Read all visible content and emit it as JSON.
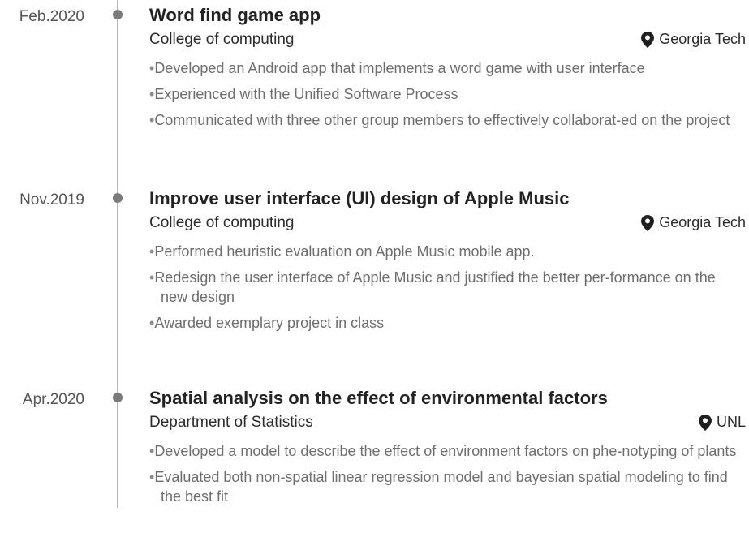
{
  "entries": [
    {
      "date": "Feb.2020",
      "title": "Word find game app",
      "org": "College of computing",
      "location": "Georgia Tech",
      "bullets": [
        "Developed an Android app that implements a word game with user interface",
        "Experienced with the Unified Software Process",
        "Communicated with three other group members to effectively collaborat-ed on the project"
      ]
    },
    {
      "date": "Nov.2019",
      "title": "Improve user interface (UI) design of Apple Music",
      "org": "College of computing",
      "location": "Georgia Tech",
      "bullets": [
        "Performed heuristic evaluation on Apple Music mobile app.",
        "Redesign the user interface of Apple Music and justified the better per-formance on the new design",
        "Awarded exemplary project in class"
      ]
    },
    {
      "date": "Apr.2020",
      "title": "Spatial analysis on the effect of environmental factors",
      "org": "Department of Statistics",
      "location": "UNL",
      "bullets": [
        "Developed a model to describe the effect of environment factors on phe-notyping of plants",
        "Evaluated both non-spatial linear regression model and bayesian spatial modeling to find the best fit"
      ]
    }
  ],
  "icons": {
    "location": "map-pin-icon"
  },
  "colors": {
    "dot": "#7a7a7a",
    "line": "#b8b8b8",
    "bullet_text": "#6e6e6e"
  }
}
